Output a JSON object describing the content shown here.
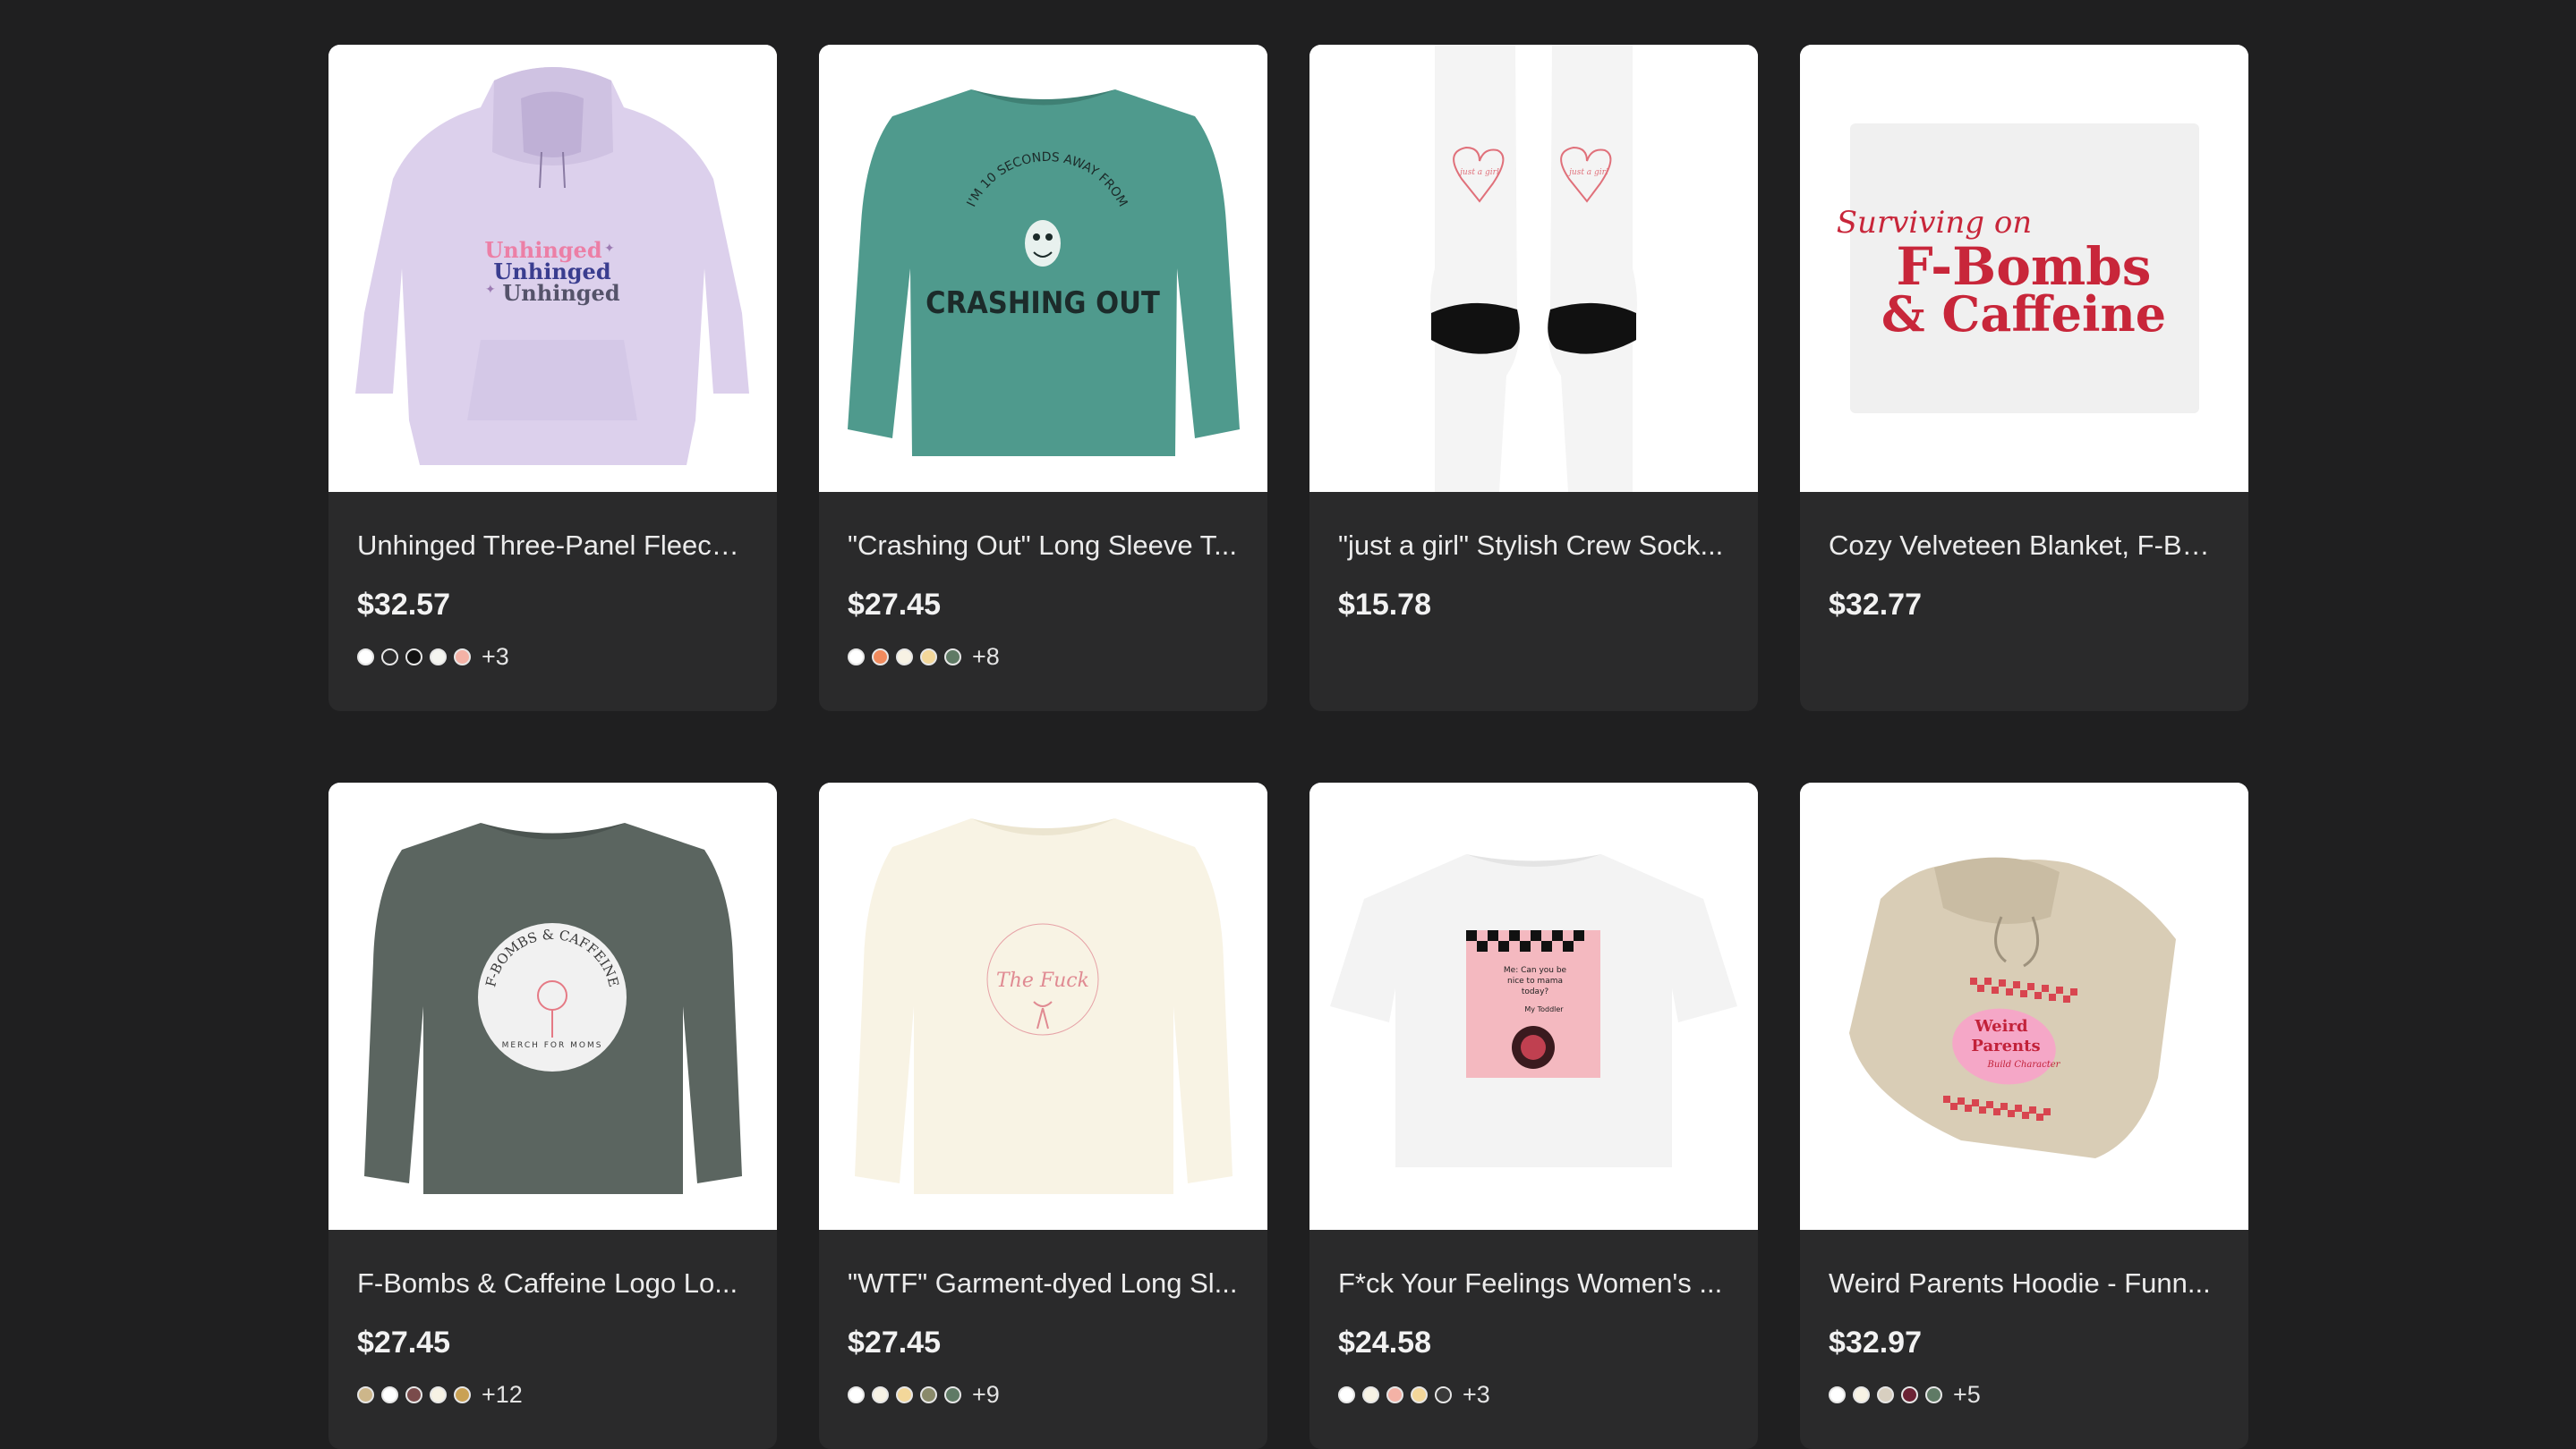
{
  "products": [
    {
      "title": "Unhinged Three-Panel Fleece...",
      "price": "$32.57",
      "image": "lavender-hoodie-unhinged",
      "swatches": [
        "#ffffff",
        "#2a2a2b",
        "#111111",
        "#f5f5f0",
        "#f4b2a6"
      ],
      "more": "+3"
    },
    {
      "title": "\"Crashing Out\" Long Sleeve T...",
      "price": "$27.45",
      "image": "teal-long-sleeve-crashing-out",
      "swatches": [
        "#ffffff",
        "#f08a5d",
        "#f7f2e4",
        "#f3d79a",
        "#5f7a65"
      ],
      "more": "+8"
    },
    {
      "title": "\"just a girl\" Stylish Crew Sock...",
      "price": "$15.78",
      "image": "white-crew-socks-bow",
      "swatches": [],
      "more": ""
    },
    {
      "title": "Cozy Velveteen Blanket, F-Bo...",
      "price": "$32.77",
      "image": "velveteen-blanket-fbombs",
      "swatches": [],
      "more": ""
    },
    {
      "title": "F-Bombs & Caffeine Logo Lo...",
      "price": "$27.45",
      "image": "gray-long-sleeve-logo",
      "swatches": [
        "#cdb68a",
        "#ffffff",
        "#7a4b4b",
        "#f7f2e4",
        "#c9a154"
      ],
      "more": "+12"
    },
    {
      "title": "\"WTF\" Garment-dyed Long Sl...",
      "price": "$27.45",
      "image": "ivory-long-sleeve-wtf",
      "swatches": [
        "#ffffff",
        "#f7f2e4",
        "#f3d79a",
        "#8a8a6a",
        "#5f7a65"
      ],
      "more": "+9"
    },
    {
      "title": "F*ck Your Feelings Women's ...",
      "price": "$24.58",
      "image": "white-tee-pink-graphic",
      "swatches": [
        "#ffffff",
        "#f7f2e4",
        "#f4b2a6",
        "#f3d79a",
        "#3a3a3a"
      ],
      "more": "+3"
    },
    {
      "title": "Weird Parents Hoodie - Funn...",
      "price": "$32.97",
      "image": "sand-hoodie-weird-parents",
      "swatches": [
        "#ffffff",
        "#f7f2e4",
        "#d8cfc0",
        "#6b2234",
        "#5f7a65"
      ],
      "more": "+5"
    }
  ],
  "artwork": {
    "unhinged": "Unhinged",
    "crashing_arc": "I'M 10 SECONDS AWAY FROM",
    "crashing_main": "CRASHING OUT",
    "socks_text": "just a girl",
    "blanket_script": "Surviving on",
    "blanket_line1": "F-Bombs",
    "blanket_line2": "& Caffeine",
    "logo_arc": "F-BOMBS & CAFFEINE",
    "logo_sub": "MERCH FOR MOMS",
    "wtf_script": "The Fuck",
    "tee_text1": "Me: Can you be",
    "tee_text2": "nice to mama",
    "tee_text3": "today?",
    "tee_text4": "My Toddler",
    "weird1": "Weird",
    "weird2": "Parents",
    "weird3": "Build Character"
  }
}
